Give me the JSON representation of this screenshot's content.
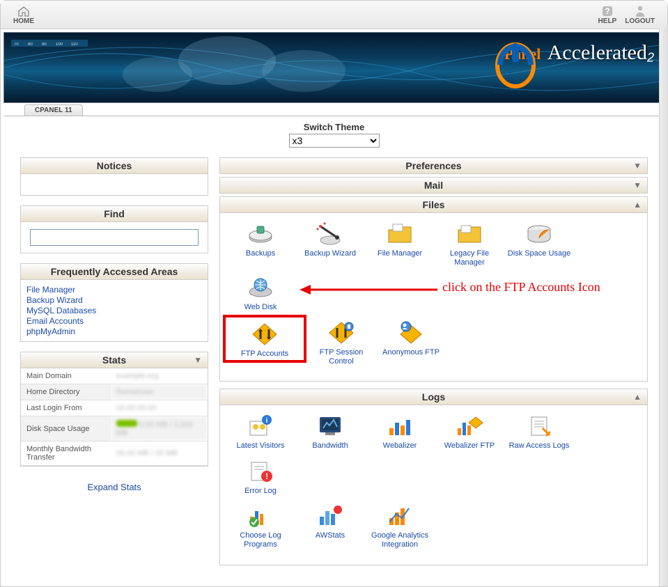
{
  "topbar": {
    "home": "HOME",
    "help": "HELP",
    "logout": "LOGOUT"
  },
  "banner": {
    "cpanel": "cPanel",
    "accel": "Accelerated",
    "subscript": "2"
  },
  "breadcrumb": "CPANEL 11",
  "switch_theme": {
    "label": "Switch Theme",
    "option": "x3"
  },
  "left": {
    "notices": {
      "title": "Notices"
    },
    "find": {
      "title": "Find",
      "value": ""
    },
    "freq": {
      "title": "Frequently Accessed Areas",
      "items": [
        "File Manager",
        "Backup Wizard",
        "MySQL Databases",
        "Email Accounts",
        "phpMyAdmin"
      ]
    },
    "stats": {
      "title": "Stats",
      "rows": [
        {
          "label": "Main Domain",
          "value": "example.org"
        },
        {
          "label": "Home Directory",
          "value": "/home/user"
        },
        {
          "label": "Last Login From",
          "value": "00.00.00.00"
        },
        {
          "label": "Disk Space Usage",
          "value": "0.00 MB / 1,000 MB",
          "bar": true
        },
        {
          "label": "Monthly Bandwidth Transfer",
          "value": "00.00 MB / 00 MB"
        }
      ],
      "expand": "Expand Stats"
    }
  },
  "right": {
    "preferences": "Preferences",
    "mail": "Mail",
    "files": {
      "title": "Files",
      "row1": [
        {
          "id": "backups",
          "label": "Backups"
        },
        {
          "id": "backup-wizard",
          "label": "Backup Wizard"
        },
        {
          "id": "file-manager",
          "label": "File Manager"
        },
        {
          "id": "legacy-file-manager",
          "label": "Legacy File Manager"
        },
        {
          "id": "disk-space-usage",
          "label": "Disk Space Usage"
        },
        {
          "id": "web-disk",
          "label": "Web Disk"
        }
      ],
      "row2": [
        {
          "id": "ftp-accounts",
          "label": "FTP Accounts",
          "hl": true
        },
        {
          "id": "ftp-session-control",
          "label": "FTP Session Control"
        },
        {
          "id": "anonymous-ftp",
          "label": "Anonymous FTP"
        }
      ]
    },
    "logs": {
      "title": "Logs",
      "row1": [
        {
          "id": "latest-visitors",
          "label": "Latest Visitors"
        },
        {
          "id": "bandwidth",
          "label": "Bandwidth"
        },
        {
          "id": "webalizer",
          "label": "Webalizer"
        },
        {
          "id": "webalizer-ftp",
          "label": "Webalizer FTP"
        },
        {
          "id": "raw-access-logs",
          "label": "Raw Access Logs"
        },
        {
          "id": "error-log",
          "label": "Error Log"
        }
      ],
      "row2": [
        {
          "id": "choose-log-programs",
          "label": "Choose Log Programs"
        },
        {
          "id": "awstats",
          "label": "AWStats"
        },
        {
          "id": "google-analytics",
          "label": "Google Analytics Integration"
        }
      ]
    }
  },
  "annotation": "click on the FTP Accounts Icon"
}
